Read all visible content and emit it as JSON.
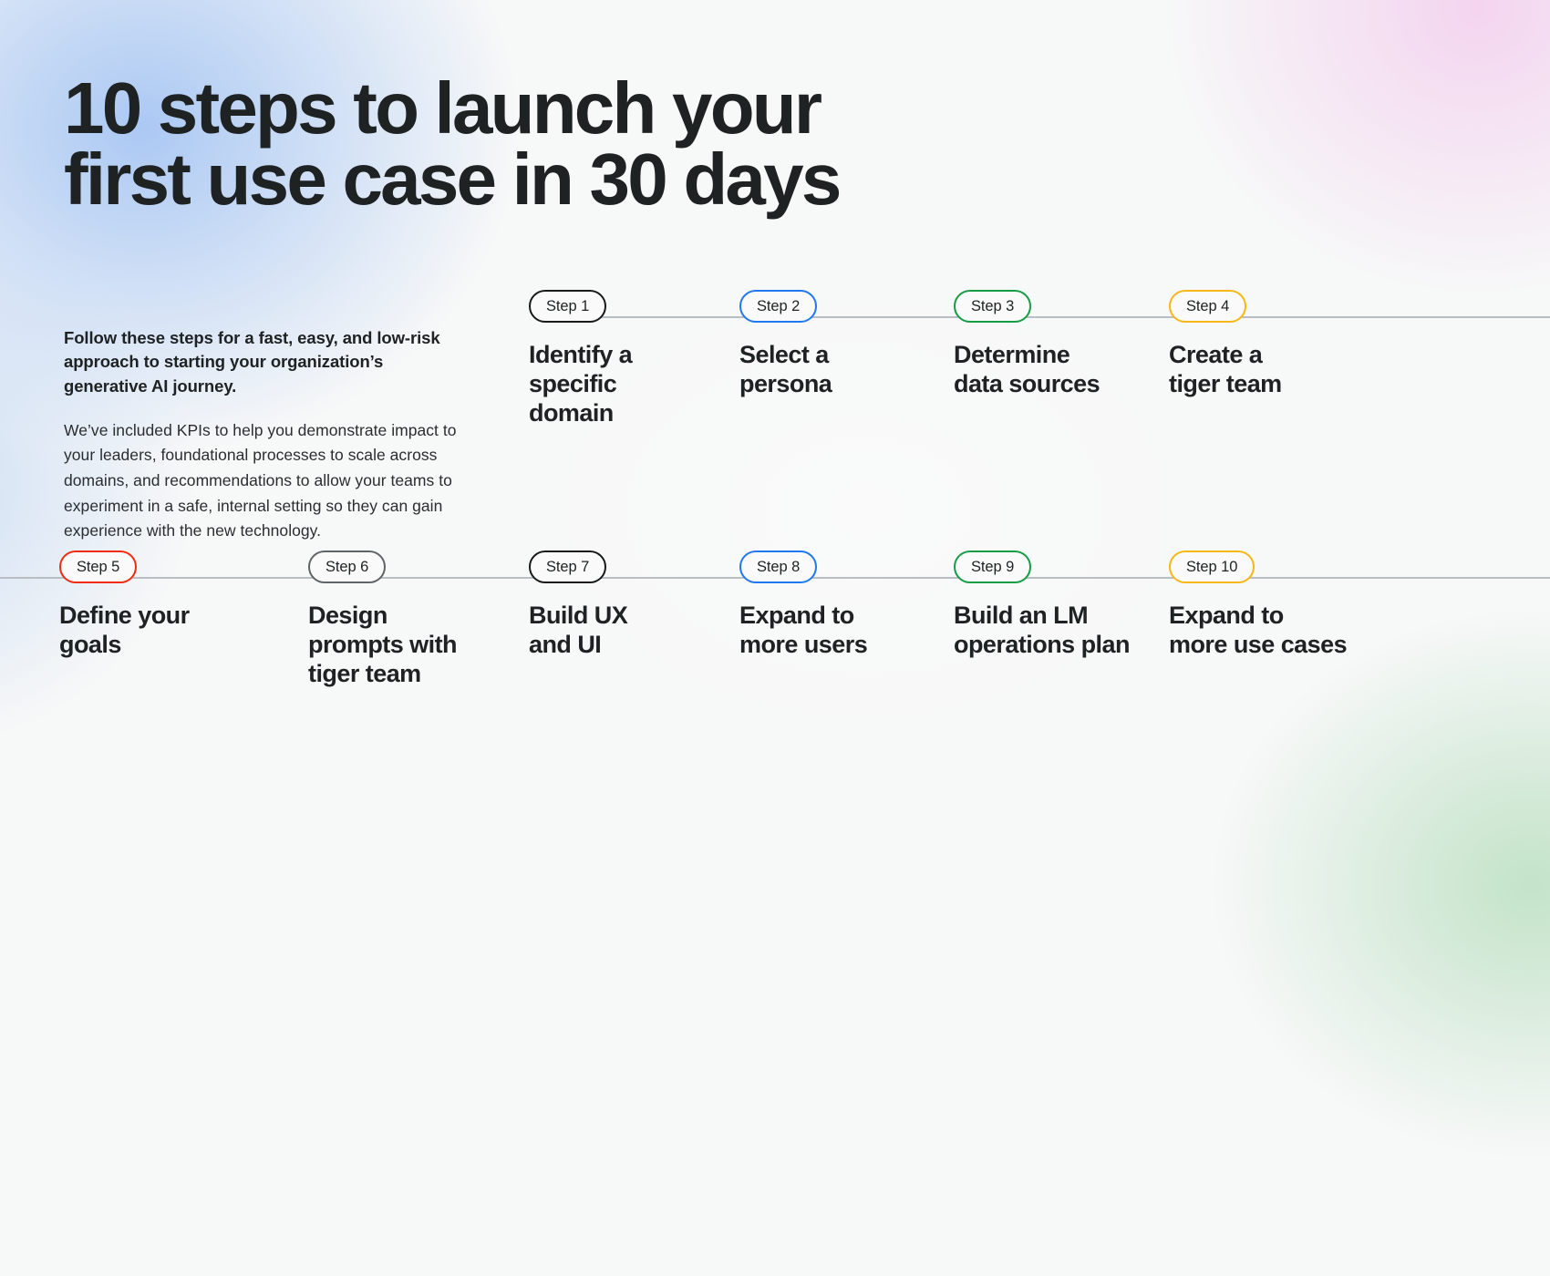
{
  "theme": {
    "text_color": "#1f2223",
    "rail_color": "#b9bec4",
    "accent_blue": "#1f78f0",
    "accent_green": "#159c45",
    "accent_yellow": "#f7b717",
    "accent_red": "#f02b10",
    "accent_grey": "#5f6468",
    "accent_black": "#17191a",
    "bg_blue": "#a7c6f3",
    "bg_pink": "#f3ceee",
    "bg_green": "#badfc0",
    "bg_base": "#f7f8f8"
  },
  "headline": {
    "line1": "10 steps to launch your",
    "line2": "first use case in 30 days"
  },
  "intro": {
    "lead": "Follow these steps for a fast, easy, and low-risk approach to starting your organization’s generative AI journey.",
    "body": "We’ve included KPIs to help you demonstrate impact to your leaders, foundational processes to scale across domains, and recommendations to allow your teams to experiment in a safe, internal setting so they can gain experience with the new technology."
  },
  "timeline": {
    "row1": [
      {
        "badge": "Step 1",
        "color": "black",
        "title": "Identify a\nspecific\ndomain"
      },
      {
        "badge": "Step 2",
        "color": "blue",
        "title": "Select a\npersona"
      },
      {
        "badge": "Step 3",
        "color": "green",
        "title": "Determine\ndata sources"
      },
      {
        "badge": "Step 4",
        "color": "yellow",
        "title": "Create a\ntiger team"
      }
    ],
    "row2": [
      {
        "badge": "Step 5",
        "color": "red",
        "title": "Define your\ngoals"
      },
      {
        "badge": "Step 6",
        "color": "grey",
        "title": "Design\nprompts with\ntiger team"
      },
      {
        "badge": "Step 7",
        "color": "black",
        "title": "Build UX\nand UI"
      },
      {
        "badge": "Step 8",
        "color": "blue",
        "title": "Expand to\nmore users"
      },
      {
        "badge": "Step 9",
        "color": "green",
        "title": "Build an LM\noperations plan"
      },
      {
        "badge": "Step 10",
        "color": "yellow",
        "title": "Expand to\nmore use cases"
      }
    ]
  }
}
